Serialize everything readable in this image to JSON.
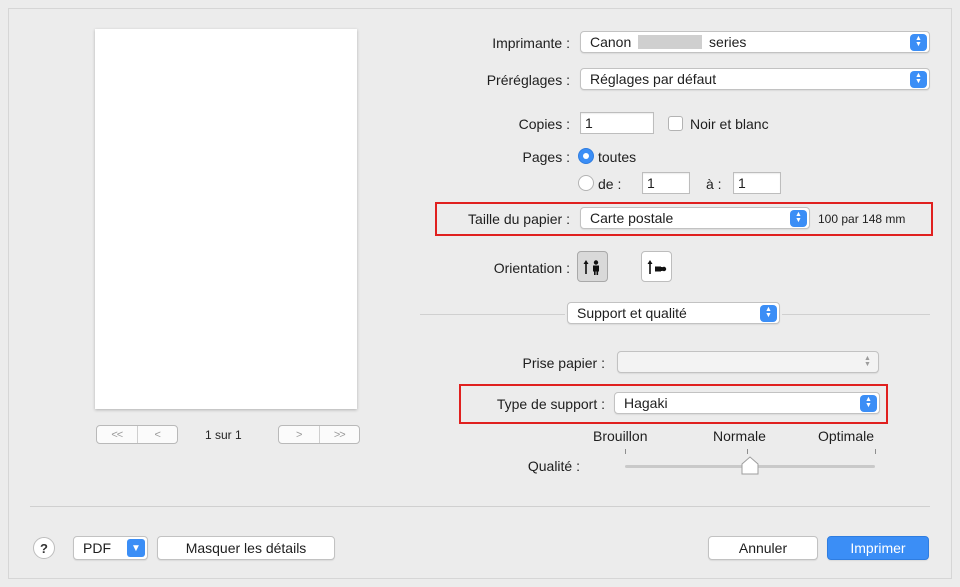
{
  "printer": {
    "label": "Imprimante :",
    "value_prefix": "Canon",
    "value_suffix": "series"
  },
  "presets": {
    "label": "Préréglages :",
    "value": "Réglages par défaut"
  },
  "copies": {
    "label": "Copies :",
    "value": "1",
    "bw_label": "Noir et blanc"
  },
  "pages": {
    "label": "Pages :",
    "all_label": "toutes",
    "from_label": "de :",
    "from_value": "1",
    "to_label": "à :",
    "to_value": "1"
  },
  "paper_size": {
    "label": "Taille du papier :",
    "value": "Carte postale",
    "dimensions": "100 par 148 mm"
  },
  "orientation": {
    "label": "Orientation :"
  },
  "section": {
    "value": "Support et qualité"
  },
  "paper_source": {
    "label": "Prise papier :",
    "value": ""
  },
  "media_type": {
    "label": "Type de support :",
    "value": "Hagaki"
  },
  "quality": {
    "label": "Qualité :",
    "options": [
      "Brouillon",
      "Normale",
      "Optimale"
    ],
    "selected": "Normale",
    "level": 0.5
  },
  "preview": {
    "page_count": "1 sur 1",
    "nav": {
      "first": "<<",
      "prev": "<",
      "next": ">",
      "last": ">>"
    }
  },
  "footer": {
    "help": "?",
    "pdf": "PDF",
    "hide_details": "Masquer les détails",
    "cancel": "Annuler",
    "print": "Imprimer"
  },
  "colors": {
    "accent": "#3b8ef6",
    "highlight": "#e0201f"
  },
  "icons": [
    "portrait-icon",
    "landscape-icon",
    "up-down-stepper-icon",
    "chevron-down-icon",
    "help-icon"
  ]
}
